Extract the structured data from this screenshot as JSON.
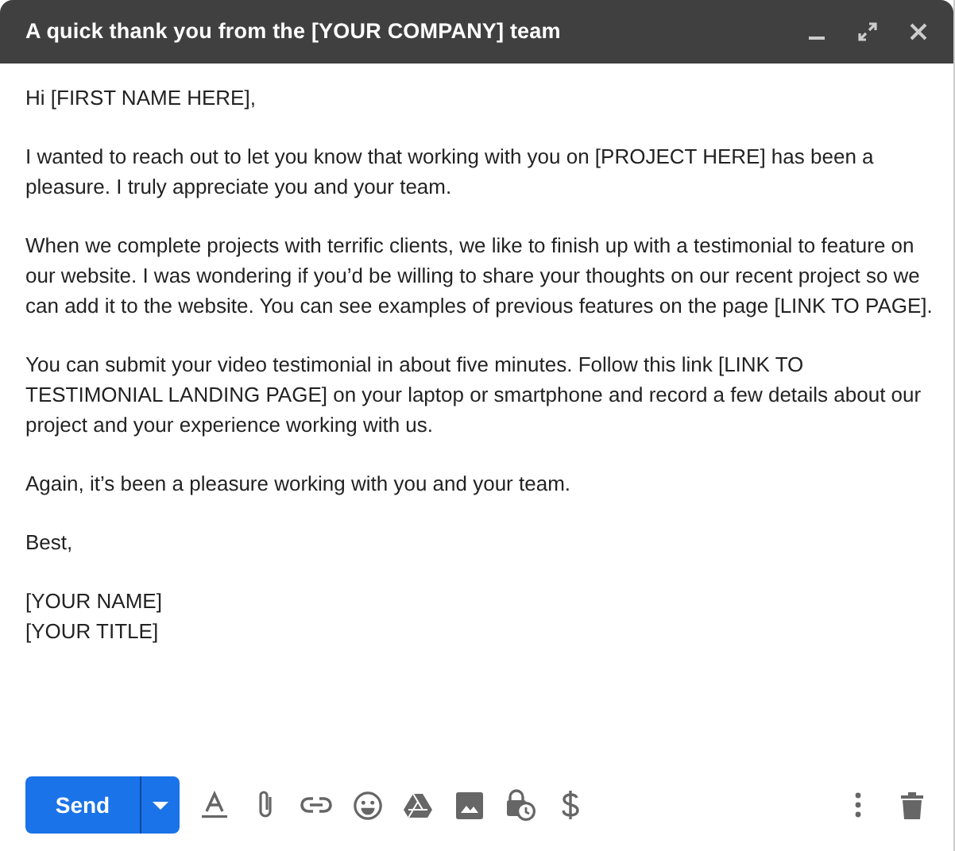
{
  "window": {
    "title": "A quick thank you from the [YOUR COMPANY] team"
  },
  "body": {
    "paragraphs": [
      "Hi [FIRST NAME HERE],",
      "I wanted to reach out to let you know that working with you on [PROJECT HERE] has been a pleasure. I truly appreciate you and your team.",
      "When we complete projects with terrific clients, we like to finish up with a testimonial to feature on our website. I was wondering if you’d be willing to share your thoughts on our recent project so we can add it to the website. You can see examples of previous features on the page [LINK TO PAGE].",
      "You can submit your video testimonial in about five minutes. Follow this link [LINK TO TESTIMONIAL LANDING PAGE] on your laptop or smartphone and record a few details about our project and your experience working with us.",
      "Again, it’s been a pleasure working with you and your team.",
      "Best,"
    ],
    "signature": [
      "[YOUR NAME]",
      "[YOUR TITLE]"
    ]
  },
  "toolbar": {
    "send_label": "Send"
  }
}
